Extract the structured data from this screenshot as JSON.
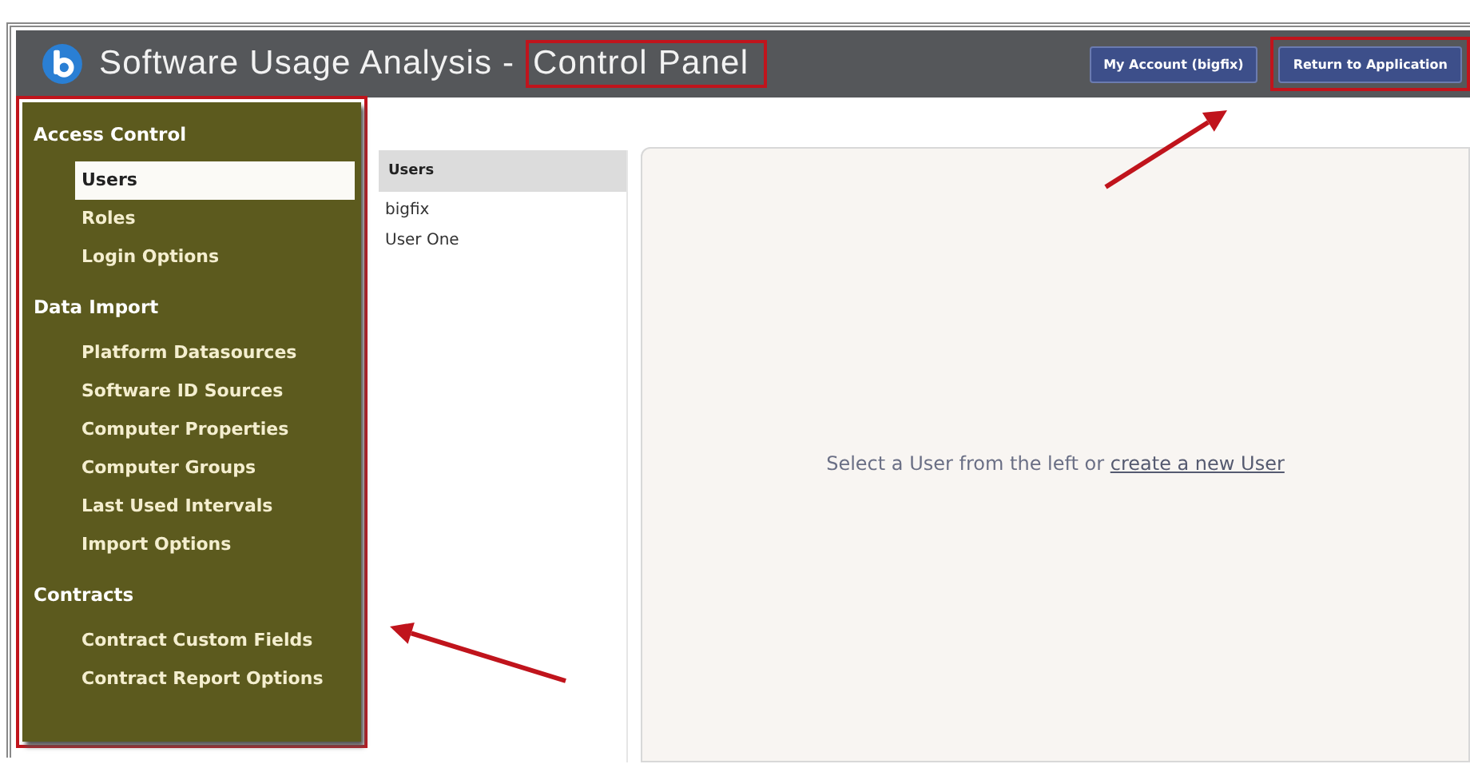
{
  "header": {
    "title": "Software Usage Analysis - ",
    "title_highlight": {
      "text": "Control Panel",
      "highlighted": true
    },
    "buttons": [
      {
        "label": "My Account (bigfix)",
        "highlighted": false
      },
      {
        "label": "Return to Application",
        "highlighted": true
      }
    ],
    "pointer_arrow": true
  },
  "sidebar": {
    "highlighted": true,
    "pointer_arrow": true,
    "sections": [
      {
        "title": "Access Control",
        "items": [
          {
            "label": "Users",
            "selected": true
          },
          {
            "label": "Roles",
            "selected": false
          },
          {
            "label": "Login Options",
            "selected": false
          }
        ]
      },
      {
        "title": "Data Import",
        "items": [
          {
            "label": "Platform Datasources",
            "selected": false
          },
          {
            "label": "Software ID Sources",
            "selected": false
          },
          {
            "label": "Computer Properties",
            "selected": false
          },
          {
            "label": "Computer Groups",
            "selected": false
          },
          {
            "label": "Last Used Intervals",
            "selected": false
          },
          {
            "label": "Import Options",
            "selected": false
          }
        ]
      },
      {
        "title": "Contracts",
        "items": [
          {
            "label": "Contract Custom Fields",
            "selected": false
          },
          {
            "label": "Contract Report Options",
            "selected": false
          }
        ]
      }
    ]
  },
  "users_list": {
    "header": "Users",
    "items": [
      "bigfix",
      "User One"
    ]
  },
  "main": {
    "message": "Select a User from the left or ",
    "link": "create a new User"
  }
}
